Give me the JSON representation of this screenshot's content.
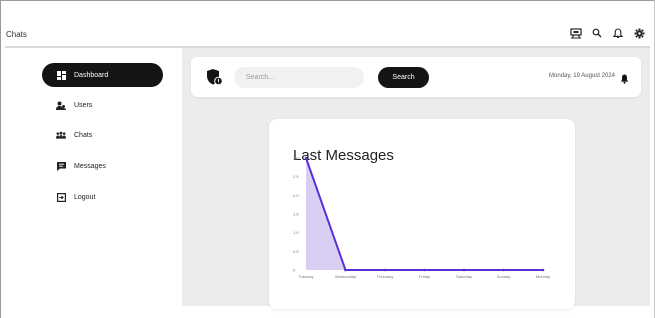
{
  "header": {
    "title": "Chats",
    "icons": [
      "overview-icon",
      "search-icon",
      "notification-icon",
      "settings-icon"
    ]
  },
  "sidebar": {
    "items": [
      {
        "label": "Dashboard",
        "icon": "dashboard-icon",
        "active": true
      },
      {
        "label": "Users",
        "icon": "users-icon",
        "active": false
      },
      {
        "label": "Chats",
        "icon": "chats-icon",
        "active": false
      },
      {
        "label": "Messages",
        "icon": "messages-icon",
        "active": false
      },
      {
        "label": "Logout",
        "icon": "logout-icon",
        "active": false
      }
    ]
  },
  "search": {
    "placeholder": "Search...",
    "value": "",
    "button_label": "Search"
  },
  "date": "Monday, 19 August 2024",
  "colors": {
    "accent": "#5b2fd6",
    "accent_fill": "#d9cff5",
    "dark": "#141414",
    "main_bg": "#ececec"
  },
  "chart_data": {
    "type": "area",
    "title": "Last Messages",
    "categories": [
      "Tuesday",
      "Wednesday",
      "Thursday",
      "Friday",
      "Saturday",
      "Sunday",
      "Monday"
    ],
    "values": [
      3,
      0,
      0,
      0,
      0,
      0,
      0
    ],
    "ylim": [
      0,
      3
    ],
    "yticks": [
      "0",
      "0.5",
      "1.0",
      "1.5",
      "2.0",
      "2.5",
      "3.0"
    ],
    "xlabel": "",
    "ylabel": "",
    "grid": false
  }
}
